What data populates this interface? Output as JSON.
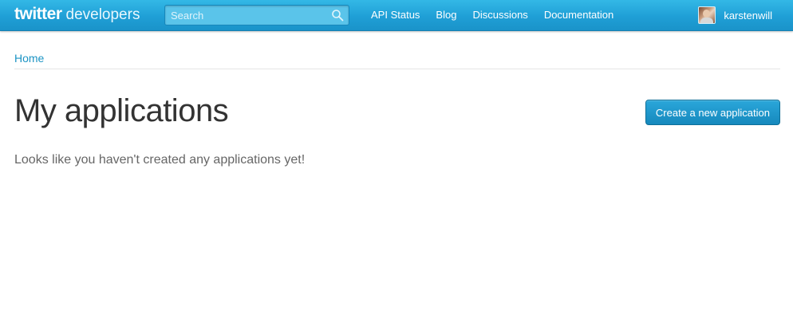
{
  "header": {
    "logo_word": "twitter",
    "logo_sub": "developers",
    "search_placeholder": "Search",
    "nav": [
      {
        "label": "API Status"
      },
      {
        "label": "Blog"
      },
      {
        "label": "Discussions"
      },
      {
        "label": "Documentation"
      }
    ],
    "username": "karstenwill"
  },
  "breadcrumb": {
    "home": "Home"
  },
  "main": {
    "title": "My applications",
    "create_button": "Create a new application",
    "empty_message": "Looks like you haven't created any applications yet!"
  },
  "colors": {
    "topbar": "#1f9fd6",
    "link": "#1c94c4",
    "button": "#1a8fc4"
  }
}
